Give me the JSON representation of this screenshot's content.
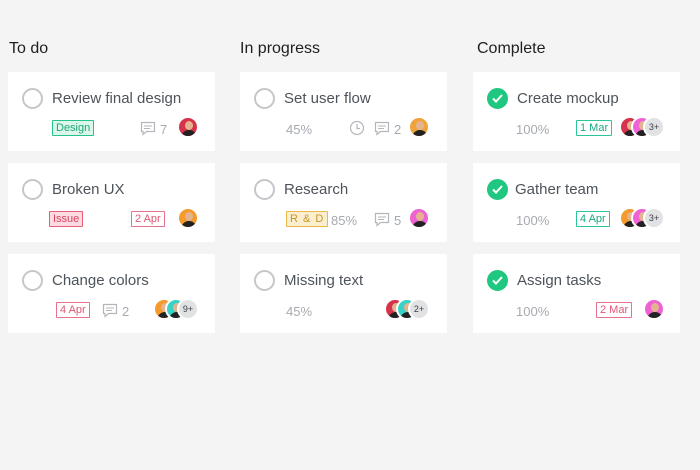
{
  "columns": [
    {
      "title": "To do",
      "cards": [
        {
          "title": "Review final design",
          "tag": "Design",
          "comments": "7"
        },
        {
          "title": "Broken UX",
          "tag": "Issue",
          "date": "2 Apr"
        },
        {
          "title": "Change colors",
          "date": "4 Apr",
          "comments": "2",
          "more": "9+"
        }
      ]
    },
    {
      "title": "In progress",
      "cards": [
        {
          "title": "Set user flow",
          "percent": "45%",
          "comments": "2"
        },
        {
          "title": "Research",
          "tag": "R & D",
          "percent": "85%",
          "comments": "5"
        },
        {
          "title": "Missing text",
          "percent": "45%",
          "more": "2+"
        }
      ]
    },
    {
      "title": "Complete",
      "cards": [
        {
          "title": "Create mockup",
          "percent": "100%",
          "date": "1 Mar",
          "more": "3+"
        },
        {
          "title": "Gather team",
          "percent": "100%",
          "date": "4 Apr",
          "more": "3+"
        },
        {
          "title": "Assign tasks",
          "percent": "100%",
          "date": "2 Mar"
        }
      ]
    }
  ],
  "icons": {
    "check": "checkmark-icon",
    "comment": "comment-icon",
    "clock": "clock-icon",
    "avatar": "avatar-icon"
  },
  "colors": {
    "complete_green": "#1fc780",
    "design_tag": "#25c486",
    "issue_tag": "#ea5d78",
    "rd_tag": "#e9b948"
  }
}
